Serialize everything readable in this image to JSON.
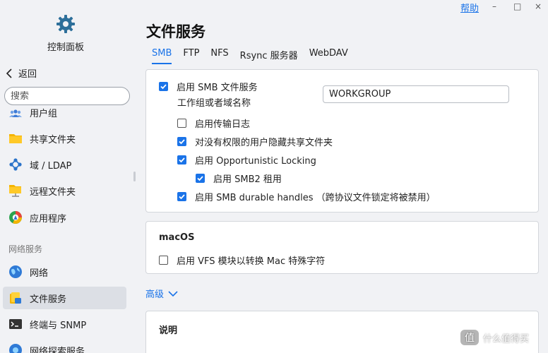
{
  "header": {
    "help_label": "帮助",
    "minimize": "–",
    "maximize": "□",
    "close": "×"
  },
  "sidebar": {
    "control_panel_label": "控制面板",
    "back_label": "返回",
    "search_placeholder": "搜索",
    "items": [
      {
        "label": "用户组"
      },
      {
        "label": "共享文件夹"
      },
      {
        "label": "域 / LDAP"
      },
      {
        "label": "远程文件夹"
      },
      {
        "label": "应用程序"
      }
    ],
    "section_label": "网络服务",
    "network_items": [
      {
        "label": "网络"
      },
      {
        "label": "文件服务"
      },
      {
        "label": "终端与 SNMP"
      },
      {
        "label": "网络探索服务"
      }
    ]
  },
  "main": {
    "title": "文件服务",
    "tabs": [
      {
        "label": "SMB"
      },
      {
        "label": "FTP"
      },
      {
        "label": "NFS"
      },
      {
        "label": "Rsync 服务器"
      },
      {
        "label": "WebDAV"
      }
    ],
    "smb": {
      "enable_label": "启用 SMB 文件服务",
      "workgroup_label": "工作组或者域名称",
      "workgroup_value": "WORKGROUP",
      "transfer_log_label": "启用传输日志",
      "hide_label": "对没有权限的用户隐藏共享文件夹",
      "oplock_label": "启用 Opportunistic Locking",
      "smb2_lease_label": "启用 SMB2 租用",
      "durable_label": "启用 SMB durable handles （跨协议文件锁定将被禁用）"
    },
    "macos": {
      "title": "macOS",
      "vfs_label": "启用 VFS 模块以转换 Mac 特殊字符"
    },
    "advanced_label": "高级",
    "next_section_title": "说明"
  },
  "watermark": {
    "text": "什么值得买"
  },
  "colors": {
    "accent": "#1a73e8",
    "active_nav": "#dcdfe5"
  }
}
